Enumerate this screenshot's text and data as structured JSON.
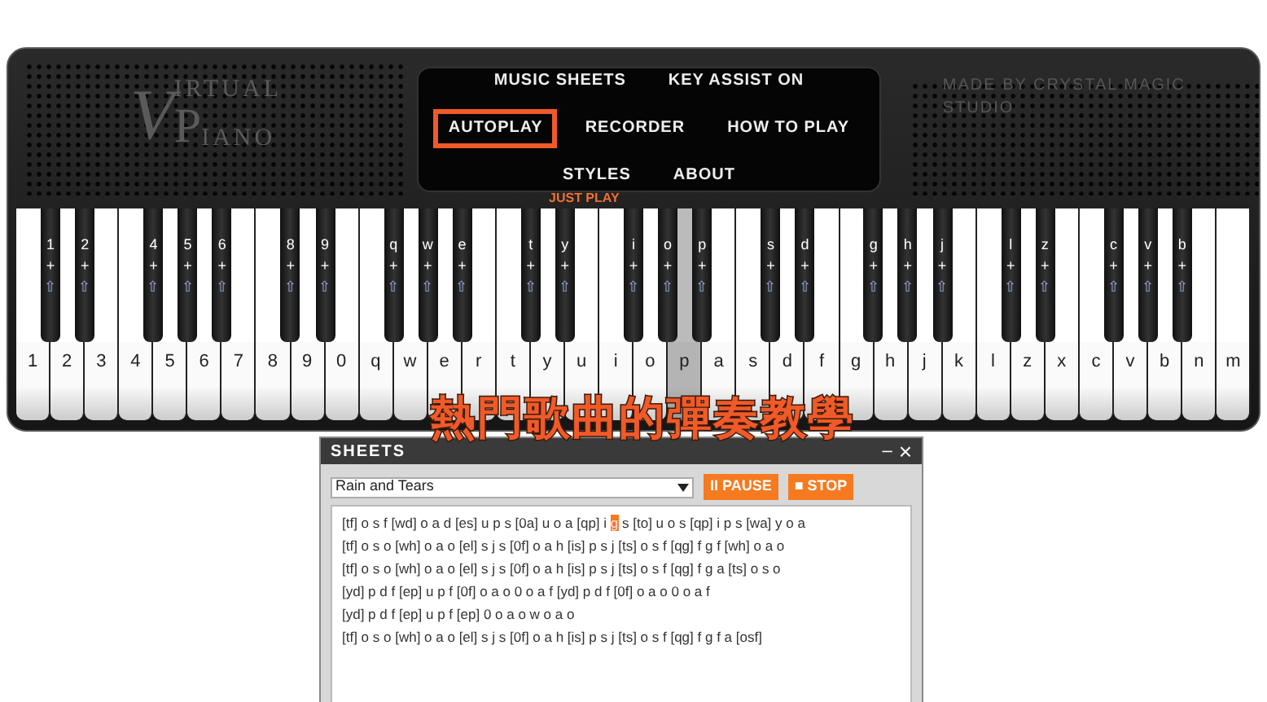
{
  "logo": {
    "initial_1": "V",
    "word_1": "IRTUAL",
    "initial_2": "P",
    "word_2": "IANO"
  },
  "credit": "MADE BY CRYSTAL MAGIC STUDIO",
  "menu": [
    [
      {
        "label": "MUSIC SHEETS",
        "highlighted": false
      },
      {
        "label": "KEY ASSIST ON",
        "highlighted": false
      }
    ],
    [
      {
        "label": "AUTOPLAY",
        "highlighted": true
      },
      {
        "label": "RECORDER",
        "highlighted": false
      },
      {
        "label": "HOW TO PLAY",
        "highlighted": false
      }
    ],
    [
      {
        "label": "STYLES",
        "highlighted": false
      },
      {
        "label": "ABOUT",
        "highlighted": false
      }
    ]
  ],
  "mode_label": "JUST PLAY",
  "white_keys": [
    {
      "label": "1",
      "pressed": false
    },
    {
      "label": "2",
      "pressed": false
    },
    {
      "label": "3",
      "pressed": false
    },
    {
      "label": "4",
      "pressed": false
    },
    {
      "label": "5",
      "pressed": false
    },
    {
      "label": "6",
      "pressed": false
    },
    {
      "label": "7",
      "pressed": false
    },
    {
      "label": "8",
      "pressed": false
    },
    {
      "label": "9",
      "pressed": false
    },
    {
      "label": "0",
      "pressed": false
    },
    {
      "label": "q",
      "pressed": false
    },
    {
      "label": "w",
      "pressed": false
    },
    {
      "label": "e",
      "pressed": false
    },
    {
      "label": "r",
      "pressed": false
    },
    {
      "label": "t",
      "pressed": false
    },
    {
      "label": "y",
      "pressed": false
    },
    {
      "label": "u",
      "pressed": false
    },
    {
      "label": "i",
      "pressed": false
    },
    {
      "label": "o",
      "pressed": false
    },
    {
      "label": "p",
      "pressed": true
    },
    {
      "label": "a",
      "pressed": false
    },
    {
      "label": "s",
      "pressed": false
    },
    {
      "label": "d",
      "pressed": false
    },
    {
      "label": "f",
      "pressed": false
    },
    {
      "label": "g",
      "pressed": false
    },
    {
      "label": "h",
      "pressed": false
    },
    {
      "label": "j",
      "pressed": false
    },
    {
      "label": "k",
      "pressed": false
    },
    {
      "label": "l",
      "pressed": false
    },
    {
      "label": "z",
      "pressed": false
    },
    {
      "label": "x",
      "pressed": false
    },
    {
      "label": "c",
      "pressed": false
    },
    {
      "label": "v",
      "pressed": false
    },
    {
      "label": "b",
      "pressed": false
    },
    {
      "label": "n",
      "pressed": false
    },
    {
      "label": "m",
      "pressed": false
    }
  ],
  "black_keys": [
    {
      "label": "1",
      "plus": "+",
      "shift": "⇧"
    },
    {
      "label": "2",
      "plus": "+",
      "shift": "⇧"
    },
    {
      "label": "4",
      "plus": "+",
      "shift": "⇧"
    },
    {
      "label": "5",
      "plus": "+",
      "shift": "⇧"
    },
    {
      "label": "6",
      "plus": "+",
      "shift": "⇧"
    },
    {
      "label": "8",
      "plus": "+",
      "shift": "⇧"
    },
    {
      "label": "9",
      "plus": "+",
      "shift": "⇧"
    },
    {
      "label": "q",
      "plus": "+",
      "shift": "⇧"
    },
    {
      "label": "w",
      "plus": "+",
      "shift": "⇧"
    },
    {
      "label": "e",
      "plus": "+",
      "shift": "⇧"
    },
    {
      "label": "t",
      "plus": "+",
      "shift": "⇧"
    },
    {
      "label": "y",
      "plus": "+",
      "shift": "⇧"
    },
    {
      "label": "i",
      "plus": "+",
      "shift": "⇧"
    },
    {
      "label": "o",
      "plus": "+",
      "shift": "⇧"
    },
    {
      "label": "p",
      "plus": "+",
      "shift": "⇧"
    },
    {
      "label": "s",
      "plus": "+",
      "shift": "⇧"
    },
    {
      "label": "d",
      "plus": "+",
      "shift": "⇧"
    },
    {
      "label": "g",
      "plus": "+",
      "shift": "⇧"
    },
    {
      "label": "h",
      "plus": "+",
      "shift": "⇧"
    },
    {
      "label": "j",
      "plus": "+",
      "shift": "⇧"
    },
    {
      "label": "l",
      "plus": "+",
      "shift": "⇧"
    },
    {
      "label": "z",
      "plus": "+",
      "shift": "⇧"
    },
    {
      "label": "c",
      "plus": "+",
      "shift": "⇧"
    },
    {
      "label": "v",
      "plus": "+",
      "shift": "⇧"
    },
    {
      "label": "b",
      "plus": "+",
      "shift": "⇧"
    }
  ],
  "annotation": "熱門歌曲的彈奏教學",
  "sheets": {
    "title": "SHEETS",
    "minimize": "–",
    "close": "×",
    "song": "Rain and Tears",
    "pause": "II PAUSE",
    "stop": "■ STOP",
    "lines": [
      [
        {
          "text": "[tf] o s f [wd] o a d [es] u p s [0a] u o a [qp] i ",
          "highlighted": false
        },
        {
          "text": "g",
          "highlighted": true
        },
        {
          "text": " s [to] u o s [qp] i p s [wa] y o a",
          "highlighted": false
        }
      ],
      [
        {
          "text": "[tf] o s o [wh] o a o [el] s j s [0f] o a h [is] p s j [ts] o s f [qg] f g f [wh] o a o",
          "highlighted": false
        }
      ],
      [
        {
          "text": "[tf] o s o [wh] o a o [el] s j s [0f] o a h [is] p s j [ts] o s f [qg] f g a [ts] o s o",
          "highlighted": false
        }
      ],
      [
        {
          "text": "[yd] p d f [ep] u p f [0f] o a o 0 o a f [yd] p d f [0f] o a o 0 o a f",
          "highlighted": false
        }
      ],
      [
        {
          "text": "[yd] p d f [ep] u p f [ep] 0 o a o w o a o",
          "highlighted": false
        }
      ],
      [
        {
          "text": "[tf] o s o [wh] o a o [el] s j s [0f] o a h [is] p s j [ts] o s f [qg] f g f a [osf]",
          "highlighted": false
        }
      ]
    ]
  }
}
